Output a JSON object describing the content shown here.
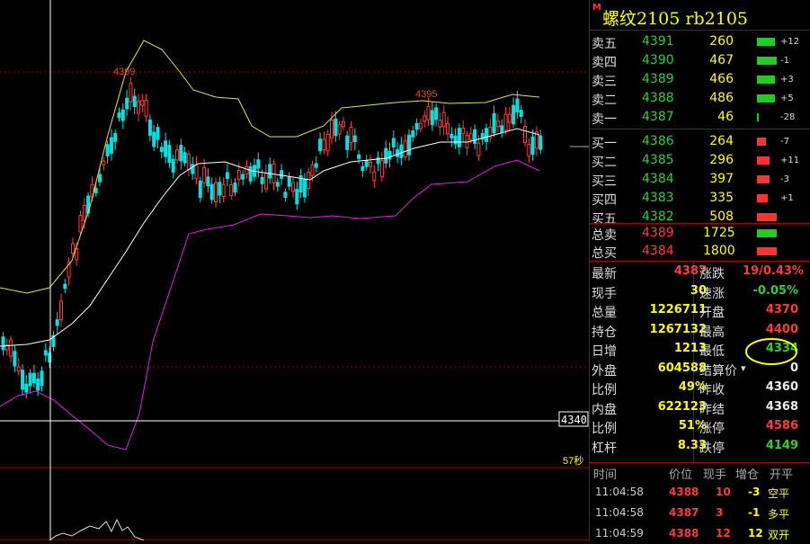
{
  "chart": {
    "label_high": "4399",
    "label_second_high": "4395",
    "crosshair_price": "4340",
    "countdown": "57秒"
  },
  "header": {
    "marker": "M",
    "title": "螺纹2105  rb2105"
  },
  "asks": [
    {
      "label": "卖五",
      "price": "4391",
      "vol": "260",
      "chg": "+12"
    },
    {
      "label": "卖四",
      "price": "4390",
      "vol": "467",
      "chg": "-1"
    },
    {
      "label": "卖三",
      "price": "4389",
      "vol": "466",
      "chg": "+3"
    },
    {
      "label": "卖二",
      "price": "4388",
      "vol": "486",
      "chg": "+5"
    },
    {
      "label": "卖一",
      "price": "4387",
      "vol": "46",
      "chg": "-28"
    }
  ],
  "bids": [
    {
      "label": "买一",
      "price": "4386",
      "vol": "264",
      "chg": "-7"
    },
    {
      "label": "买二",
      "price": "4385",
      "vol": "296",
      "chg": "+11"
    },
    {
      "label": "买三",
      "price": "4384",
      "vol": "397",
      "chg": "-3"
    },
    {
      "label": "买四",
      "price": "4383",
      "vol": "335",
      "chg": "+1"
    },
    {
      "label": "买五",
      "price": "4382",
      "vol": "508",
      "chg": ""
    }
  ],
  "totals": [
    {
      "label": "总卖",
      "price": "4389",
      "vol": "1725"
    },
    {
      "label": "总买",
      "price": "4384",
      "vol": "1800"
    }
  ],
  "stats": [
    {
      "k1": "最新",
      "v1": "4387",
      "k2": "涨跌",
      "v2": "19/0.43%"
    },
    {
      "k1": "现手",
      "v1": "30",
      "k2": "速涨",
      "v2": "-0.05%"
    },
    {
      "k1": "总量",
      "v1": "1226711",
      "k2": "开盘",
      "v2": "4370"
    },
    {
      "k1": "持仓",
      "v1": "1267132",
      "k2": "最高",
      "v2": "4400"
    },
    {
      "k1": "日增",
      "v1": "1213",
      "k2": "最低",
      "v2": "4334"
    },
    {
      "k1": "外盘",
      "v1": "604588",
      "k2": "结算价",
      "v2": "0"
    },
    {
      "k1": "比例",
      "v1": "49%",
      "k2": "昨收",
      "v2": "4360"
    },
    {
      "k1": "内盘",
      "v1": "622123",
      "k2": "昨结",
      "v2": "4368"
    },
    {
      "k1": "比例",
      "v1": "51%",
      "k2": "涨停",
      "v2": "4586"
    },
    {
      "k1": "杠杆",
      "v1": "8.33",
      "k2": "跌停",
      "v2": "4149"
    }
  ],
  "ticks_header": {
    "time": "时间",
    "price": "价位",
    "vol": "现手",
    "oi": "增仓",
    "type": "开平"
  },
  "ticks": [
    {
      "time": "11:04:58",
      "price": "4388",
      "vol": "10",
      "oi": "-3",
      "type": "空平"
    },
    {
      "time": "11:04:58",
      "price": "4387",
      "vol": "3",
      "oi": "-1",
      "type": "多平"
    },
    {
      "time": "11:04:59",
      "price": "4388",
      "vol": "12",
      "oi": "12",
      "type": "双开"
    }
  ],
  "colors": {
    "up": "#ff3b3b",
    "down": "#00e0e0",
    "mid": "#ffffff",
    "upper": "#e6e24a",
    "lower": "#e020e0",
    "frame": "#a00000"
  }
}
